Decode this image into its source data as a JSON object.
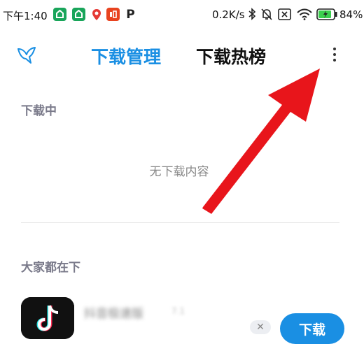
{
  "status_bar": {
    "time": "下午1:40",
    "net_speed": "0.2K/s",
    "battery": "84%",
    "notif_p": "P"
  },
  "header": {
    "tab_active": "下载管理",
    "tab_inactive": "下载热榜"
  },
  "downloading": {
    "title": "下载中",
    "empty": "无下载内容"
  },
  "everyone": {
    "title": "大家都在下",
    "app_name": "抖音极速版",
    "app_size": "7.1",
    "download_label": "下载",
    "dismiss_glyph": "✕"
  },
  "colors": {
    "accent": "#1a8fe3",
    "arrow": "#e8151b"
  }
}
